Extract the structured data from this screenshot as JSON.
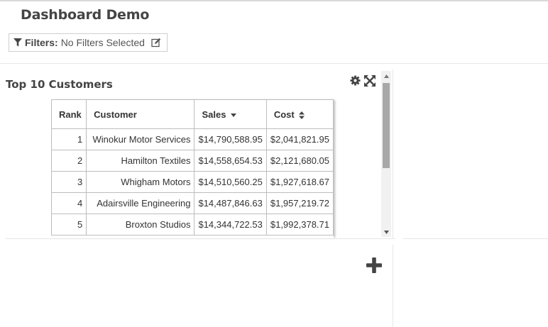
{
  "dashboard": {
    "title": "Dashboard Demo"
  },
  "filters": {
    "label": "Filters:",
    "value": "No Filters Selected"
  },
  "panel": {
    "title": "Top 10 Customers",
    "columns": {
      "rank": "Rank",
      "customer": "Customer",
      "sales": "Sales",
      "cost": "Cost"
    },
    "rows": [
      {
        "rank": "1",
        "customer": "Winokur Motor Services",
        "sales": "$14,790,588.95",
        "cost": "$2,041,821.95"
      },
      {
        "rank": "2",
        "customer": "Hamilton Textiles",
        "sales": "$14,558,654.53",
        "cost": "$2,121,680.05"
      },
      {
        "rank": "3",
        "customer": "Whigham Motors",
        "sales": "$14,510,560.25",
        "cost": "$1,927,618.67"
      },
      {
        "rank": "4",
        "customer": "Adairsville Engineering",
        "sales": "$14,487,846.63",
        "cost": "$1,957,219.72"
      },
      {
        "rank": "5",
        "customer": "Broxton Studios",
        "sales": "$14,344,722.53",
        "cost": "$1,992,378.71"
      }
    ],
    "sort": {
      "sales": "descending",
      "cost": "sortable"
    }
  },
  "icons": {
    "filter": "funnel-icon",
    "edit": "edit-icon",
    "settings": "gear-icon",
    "expand": "expand-icon",
    "add": "plus-icon"
  }
}
